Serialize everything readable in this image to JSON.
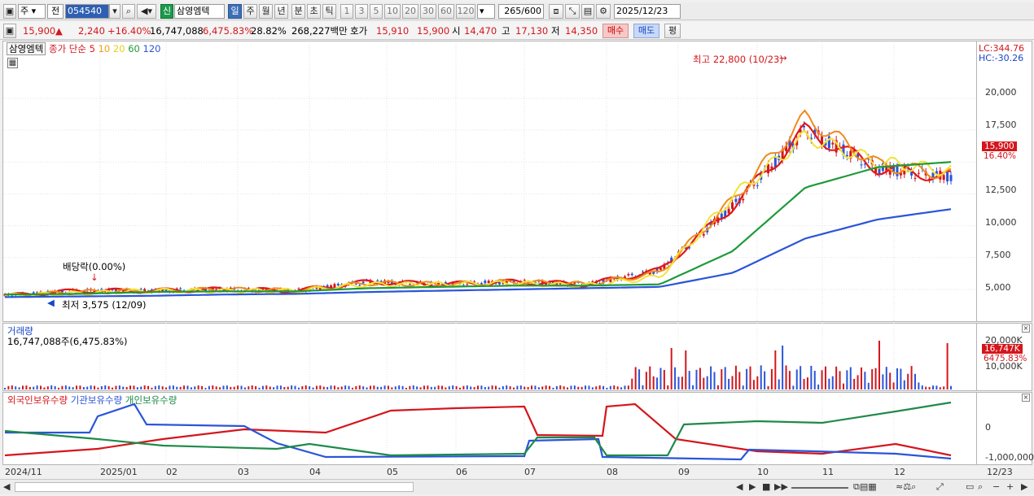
{
  "toolbar": {
    "market": "주",
    "scope": "전",
    "code": "054540",
    "name_badge": "신",
    "name": "삼영엠텍",
    "periods": [
      "일",
      "주",
      "월",
      "년",
      "분",
      "초",
      "틱"
    ],
    "minutes": [
      "1",
      "3",
      "5",
      "10",
      "20",
      "30",
      "60",
      "120"
    ],
    "count": "265",
    "count_total": "/600",
    "date": "2025/12/23"
  },
  "quote": {
    "price": "15,900",
    "change": "2,240",
    "change_pct": "+16.40%",
    "volume": "16,747,088",
    "vol_pct": "6,475.83%",
    "turnover": "28.82%",
    "amount": "268,227백만",
    "bid_label": "호가",
    "bid": "15,910",
    "ask": "15,900",
    "open_label": "시",
    "open": "14,470",
    "high_label": "고",
    "high": "17,130",
    "low_label": "저",
    "low": "14,350",
    "buy": "매수",
    "sell": "매도",
    "avg": "평"
  },
  "price_panel": {
    "stock": "삼영엠텍",
    "ma_label": "종가 단순",
    "ma_periods": [
      {
        "p": "5",
        "color": "#e01818"
      },
      {
        "p": "10",
        "color": "#f08a1a"
      },
      {
        "p": "20",
        "color": "#f2e23a"
      },
      {
        "p": "60",
        "color": "#1e9a3a"
      },
      {
        "p": "120",
        "color": "#2b55d8"
      }
    ],
    "lc": "LC:344.76",
    "hc": "HC:-30.26",
    "high_note": "최고 22,800 (10/23)",
    "low_note": "최저 3,575 (12/09)",
    "dividend_note": "배당락(0.00%)",
    "current_tag": "15,900",
    "current_pct": "16.40%",
    "y_ticks": [
      "20,000",
      "17,500",
      "15,000",
      "12,500",
      "10,000",
      "7,500",
      "5,000"
    ]
  },
  "volume_panel": {
    "title": "거래량",
    "summary": "16,747,088주(6,475.83%)",
    "y_ticks": [
      "20,000K",
      "10,000K"
    ],
    "tag": "16,747K",
    "tag_pct": "6475.83%"
  },
  "holdings_panel": {
    "foreign": "외국인보유수량",
    "inst": "기관보유수량",
    "indiv": "개인보유수량",
    "y_ticks": [
      "0",
      "-1,000,000"
    ]
  },
  "x_axis": [
    "2024/11",
    "2025/01",
    "02",
    "03",
    "04",
    "05",
    "06",
    "07",
    "08",
    "09",
    "10",
    "11",
    "12",
    "12/23"
  ],
  "chart_data": {
    "type": "line",
    "x": [
      "2024/11",
      "2025/01",
      "02",
      "03",
      "04",
      "05",
      "06",
      "07",
      "08",
      "09",
      "10",
      "11",
      "12",
      "12/23"
    ],
    "series": [
      {
        "name": "5",
        "values": [
          4500,
          4900,
          4900,
          5000,
          4900,
          5600,
          5400,
          5600,
          5400,
          6500,
          11500,
          17500,
          14500,
          13800
        ]
      },
      {
        "name": "10",
        "values": [
          4500,
          4800,
          4900,
          5000,
          4900,
          5500,
          5400,
          5600,
          5400,
          6300,
          12000,
          18500,
          14800,
          14000
        ]
      },
      {
        "name": "20",
        "values": [
          4500,
          4700,
          4900,
          4900,
          4900,
          5400,
          5400,
          5500,
          5300,
          6000,
          12300,
          17000,
          15000,
          14300
        ]
      },
      {
        "name": "60",
        "values": [
          4600,
          4650,
          4800,
          4850,
          4850,
          5100,
          5200,
          5300,
          5300,
          5400,
          8000,
          13000,
          14600,
          15000
        ]
      },
      {
        "name": "120",
        "values": [
          4400,
          4450,
          4500,
          4600,
          4650,
          4800,
          4900,
          5000,
          5100,
          5200,
          6300,
          9000,
          10500,
          11300
        ]
      }
    ],
    "ylim": [
      2700,
      23500
    ],
    "close_last": 15900,
    "high": 22800,
    "low": 3575
  }
}
